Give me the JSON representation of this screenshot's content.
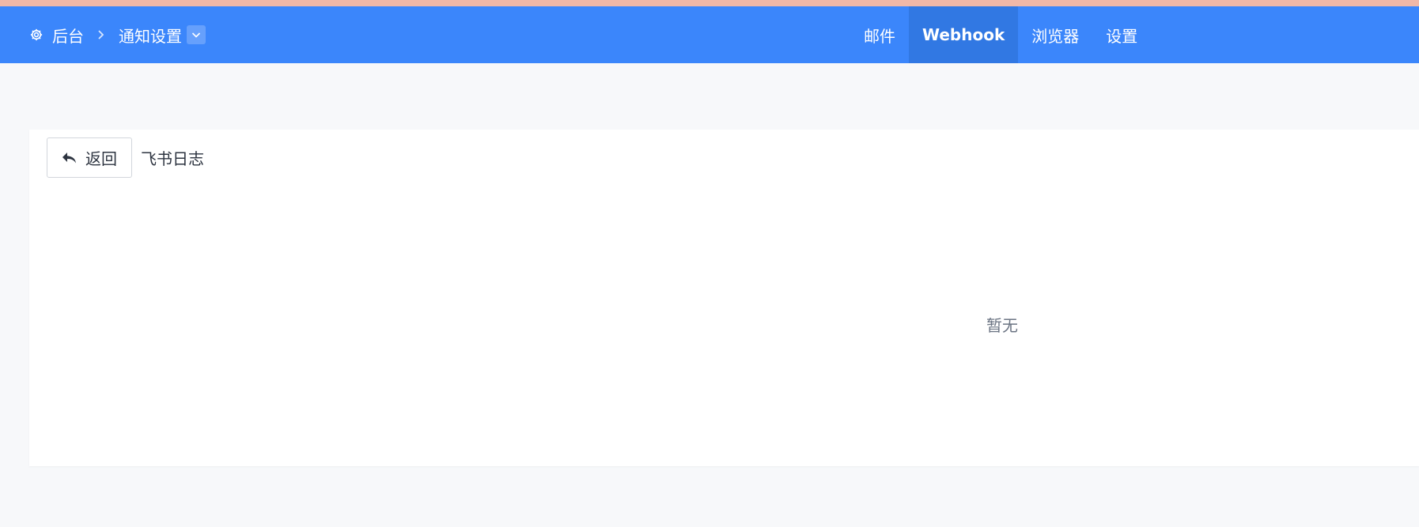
{
  "breadcrumb": {
    "root": "后台",
    "current": "通知设置"
  },
  "nav": {
    "items": [
      {
        "label": "邮件"
      },
      {
        "label": "Webhook"
      },
      {
        "label": "浏览器"
      },
      {
        "label": "设置"
      }
    ],
    "active": "Webhook"
  },
  "panel": {
    "back_label": "返回",
    "title": "飞书日志",
    "empty_text": "暂无"
  },
  "colors": {
    "header": "#3b86fb",
    "active_tab": "#3178e3",
    "top_strip": "#f0b8a8",
    "page_bg": "#f7f8fa"
  },
  "icons": {
    "breadcrumb_root": "gear-icon",
    "breadcrumb_separator": "chevron-right-icon",
    "breadcrumb_dropdown": "chevron-down-icon",
    "back": "reply-arrow-icon"
  }
}
